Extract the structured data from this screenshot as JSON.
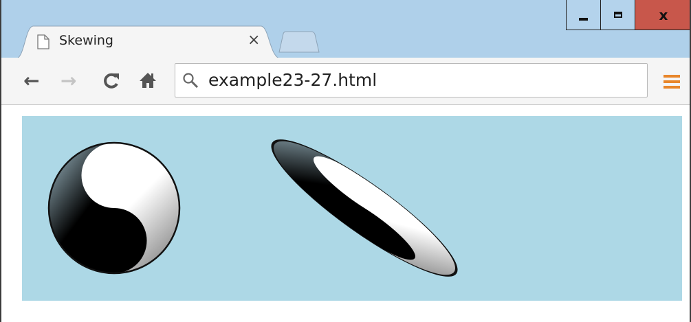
{
  "window": {
    "controls": {
      "minimize": "minimize",
      "maximize": "maximize",
      "close": "x"
    }
  },
  "tab": {
    "title": "Skewing",
    "close": "×",
    "icon": "document-icon"
  },
  "toolbar": {
    "back": "←",
    "forward": "→",
    "reload": "C",
    "home": "home-icon",
    "menu": "menu-icon"
  },
  "omnibox": {
    "url": "example23-27.html",
    "icon": "search-icon"
  },
  "colors": {
    "titlebar": "#afd0ea",
    "canvas_background": "#add8e6",
    "close_button": "#c8574b",
    "menu_accent": "#e8862a"
  },
  "canvas": {
    "figures": [
      {
        "name": "yin-yang",
        "transform": "none"
      },
      {
        "name": "yin-yang",
        "transform": "skewed"
      }
    ]
  }
}
